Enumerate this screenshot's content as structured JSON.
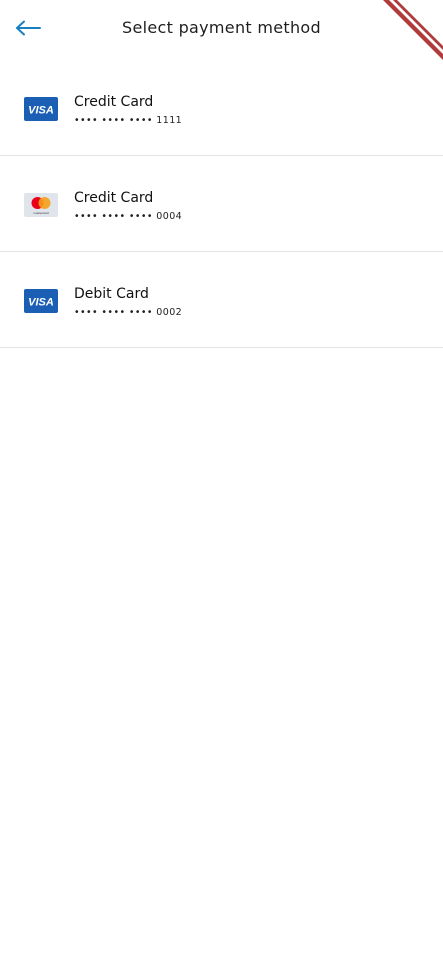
{
  "header": {
    "title": "Select payment method",
    "back_icon": "arrow-left-icon",
    "accent_color": "#1a7fc1"
  },
  "payment_methods": [
    {
      "title": "Credit Card",
      "number": "•••• •••• •••• 1111",
      "brand_icon": "visa-icon"
    },
    {
      "title": "Credit Card",
      "number": "•••• •••• •••• 0004",
      "brand_icon": "mastercard-icon"
    },
    {
      "title": "Debit Card",
      "number": "•••• •••• •••• 0002",
      "brand_icon": "visa-icon"
    }
  ],
  "colors": {
    "visa_blue": "#1a5fb4",
    "mastercard_red": "#eb001b",
    "mastercard_orange": "#f79e1b",
    "divider": "#e3e3e3",
    "debug_banner": "#b13b3b"
  },
  "brand_marks": {
    "visa_text": "VISA",
    "mastercard_text": "mastercard"
  }
}
